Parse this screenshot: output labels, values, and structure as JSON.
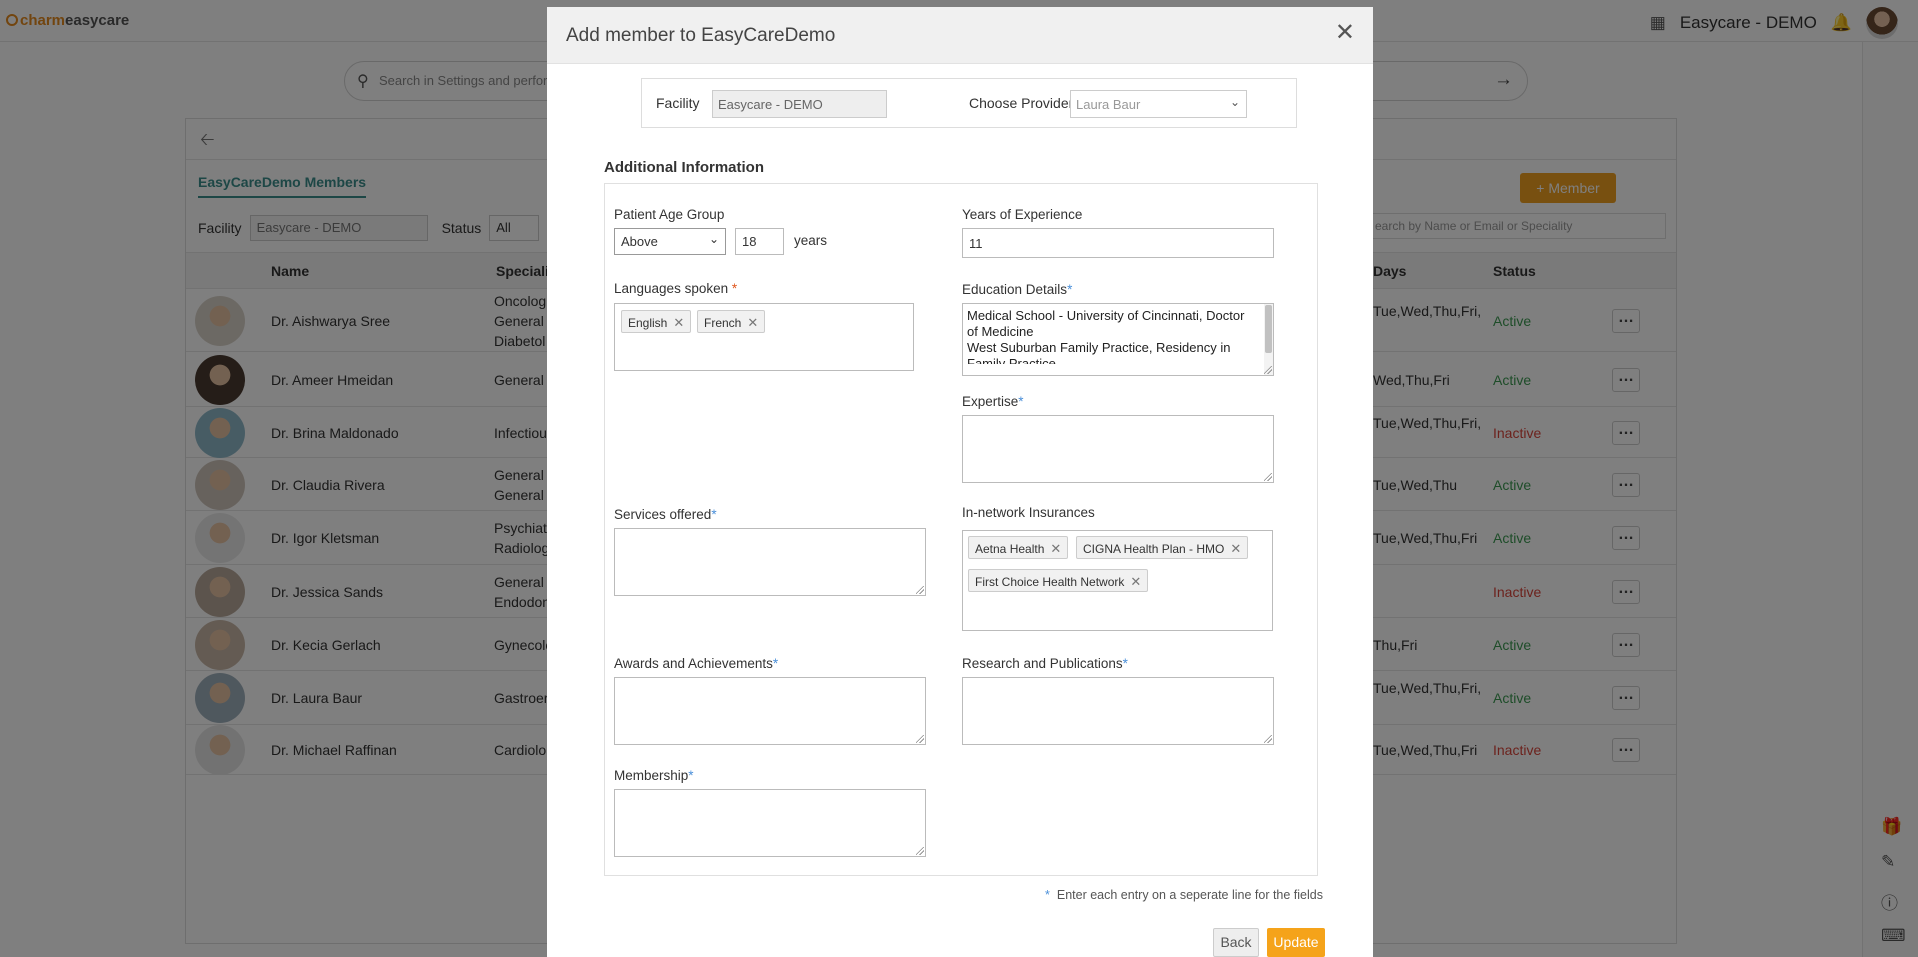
{
  "app": {
    "logo_prefix": "charm",
    "logo_suffix": "easycare",
    "facility_name": "Easycare - DEMO",
    "search_placeholder": "Search in Settings and perform",
    "tab_members": "EasyCareDemo Members",
    "filter_facility_label": "Facility",
    "filter_facility_value": "Easycare - DEMO",
    "filter_status_label": "Status",
    "filter_status_value": "All",
    "member_button": "Member",
    "search2_placeholder": "earch by Name or Email or Speciality",
    "columns": {
      "name": "Name",
      "speciality": "Speciali",
      "days": "Days",
      "status": "Status"
    },
    "members": [
      {
        "name": "Dr. Aishwarya Sree",
        "speciality": [
          "Oncologi",
          "General S",
          "Diabetol"
        ],
        "days": [
          "Tue,Wed,Thu,Fri,"
        ],
        "status": "Active"
      },
      {
        "name": "Dr. Ameer Hmeidan",
        "speciality": [
          "General"
        ],
        "days": [
          "Wed,Thu,Fri"
        ],
        "status": "Active"
      },
      {
        "name": "Dr. Brina Maldonado",
        "speciality": [
          "Infectiou"
        ],
        "days": [
          "Tue,Wed,Thu,Fri,"
        ],
        "status": "Inactive"
      },
      {
        "name": "Dr. Claudia Rivera",
        "speciality": [
          "General I",
          "General S"
        ],
        "days": [
          "Tue,Wed,Thu"
        ],
        "status": "Active"
      },
      {
        "name": "Dr. Igor Kletsman",
        "speciality": [
          "Psychiat",
          "Radiolog"
        ],
        "days": [
          "Tue,Wed,Thu,Fri"
        ],
        "status": "Active"
      },
      {
        "name": "Dr. Jessica Sands",
        "speciality": [
          "General I",
          "Endodon"
        ],
        "days": [
          ""
        ],
        "status": "Inactive"
      },
      {
        "name": "Dr. Kecia Gerlach",
        "speciality": [
          "Gynecolo"
        ],
        "days": [
          "Thu,Fri"
        ],
        "status": "Active"
      },
      {
        "name": "Dr. Laura Baur",
        "speciality": [
          "Gastroer"
        ],
        "days": [
          "Tue,Wed,Thu,Fri,"
        ],
        "status": "Active"
      },
      {
        "name": "Dr. Michael Raffinan",
        "speciality": [
          "Cardiolo"
        ],
        "days": [
          "Tue,Wed,Thu,Fri"
        ],
        "status": "Inactive"
      }
    ]
  },
  "modal": {
    "title": "Add member to EasyCareDemo",
    "facility_label": "Facility",
    "facility_value": "Easycare - DEMO",
    "provider_label": "Choose Provider",
    "provider_value": "Laura Baur",
    "section_title": "Additional Information",
    "age_group_label": "Patient Age Group",
    "age_group_option": "Above",
    "age_value": "18",
    "age_unit": "years",
    "experience_label": "Years of Experience",
    "experience_value": "11",
    "languages_label": "Languages spoken",
    "languages": [
      "English",
      "French"
    ],
    "education_label": "Education Details",
    "education_value": "Medical School - University of Cincinnati, Doctor of Medicine\nWest Suburban Family Practice, Residency in Family Practice",
    "expertise_label": "Expertise",
    "services_label": "Services offered",
    "insurances_label": "In-network Insurances",
    "insurances": [
      "Aetna Health",
      "CIGNA Health Plan - HMO",
      "First Choice Health Network"
    ],
    "awards_label": "Awards and Achievements",
    "research_label": "Research and Publications",
    "membership_label": "Membership",
    "required_mark": "*",
    "note": "Enter each entry on a seperate line for the fields",
    "back_button": "Back",
    "update_button": "Update"
  },
  "colors": {
    "accent": "#f5a31a",
    "teal": "#3a8e8c",
    "active": "#3c9a52",
    "inactive": "#d9453a",
    "required": "#4a8fd9"
  }
}
